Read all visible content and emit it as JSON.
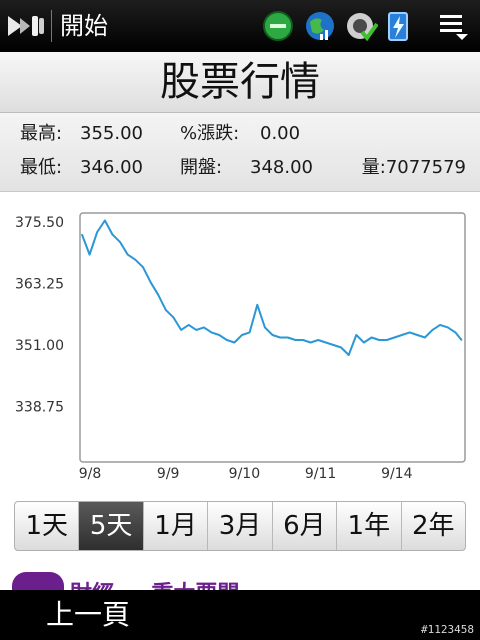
{
  "statusbar": {
    "start_label": "開始",
    "icons": [
      "windows-start-icon",
      "network-globe-icon",
      "connectivity-globe-icon",
      "speaker-muted-icon",
      "battery-charging-icon",
      "menu-icon"
    ]
  },
  "header": {
    "title": "股票行情"
  },
  "quote": {
    "high_label": "最高:",
    "high_value": "355.00",
    "change_label": "%漲跌:",
    "change_value": "0.00",
    "low_label": "最低:",
    "low_value": "346.00",
    "open_label": "開盤:",
    "open_value": "348.00",
    "volume_text": "量:7077579"
  },
  "chart_data": {
    "type": "line",
    "x_tick_labels": [
      "9/8",
      "9/9",
      "9/10",
      "9/11",
      "9/14"
    ],
    "y_tick_labels": [
      "375.50",
      "363.25",
      "351.00",
      "338.75"
    ],
    "ylim": [
      326.5,
      375.5
    ],
    "grid": false,
    "color": "#2a97d6",
    "x": [
      0,
      0.1,
      0.2,
      0.3,
      0.4,
      0.5,
      0.6,
      0.7,
      0.8,
      0.9,
      1.0,
      1.1,
      1.2,
      1.3,
      1.4,
      1.5,
      1.6,
      1.7,
      1.8,
      1.9,
      2.0,
      2.1,
      2.2,
      2.3,
      2.4,
      2.5,
      2.6,
      2.7,
      2.8,
      2.9,
      3.0,
      3.1,
      3.2,
      3.3,
      3.4,
      3.5,
      3.6,
      3.7,
      3.8,
      3.9,
      4.0,
      4.1,
      4.2,
      4.3,
      4.4,
      4.5,
      4.6,
      4.7,
      4.8,
      4.9,
      4.98
    ],
    "values": [
      373.0,
      369.0,
      373.5,
      375.8,
      373.0,
      371.5,
      369.0,
      368.0,
      366.5,
      363.5,
      361.0,
      358.0,
      356.5,
      354.0,
      355.0,
      354.0,
      354.5,
      353.5,
      353.0,
      352.0,
      351.5,
      353.0,
      353.5,
      359.0,
      354.5,
      353.0,
      352.5,
      352.5,
      352.0,
      352.0,
      351.5,
      352.0,
      351.5,
      351.0,
      350.5,
      349.0,
      353.0,
      351.5,
      352.5,
      352.0,
      352.0,
      352.5,
      353.0,
      353.5,
      353.0,
      352.5,
      354.0,
      355.0,
      354.5,
      353.5,
      352.0
    ]
  },
  "tabs": [
    {
      "label": "1天",
      "active": false
    },
    {
      "label": "5天",
      "active": true
    },
    {
      "label": "1月",
      "active": false
    },
    {
      "label": "3月",
      "active": false
    },
    {
      "label": "6月",
      "active": false
    },
    {
      "label": "1年",
      "active": false
    },
    {
      "label": "2年",
      "active": false
    }
  ],
  "banner": {
    "text": "財經 — 重大要聞"
  },
  "bottombar": {
    "back_label": "上一頁"
  },
  "watermark": "#1123458"
}
